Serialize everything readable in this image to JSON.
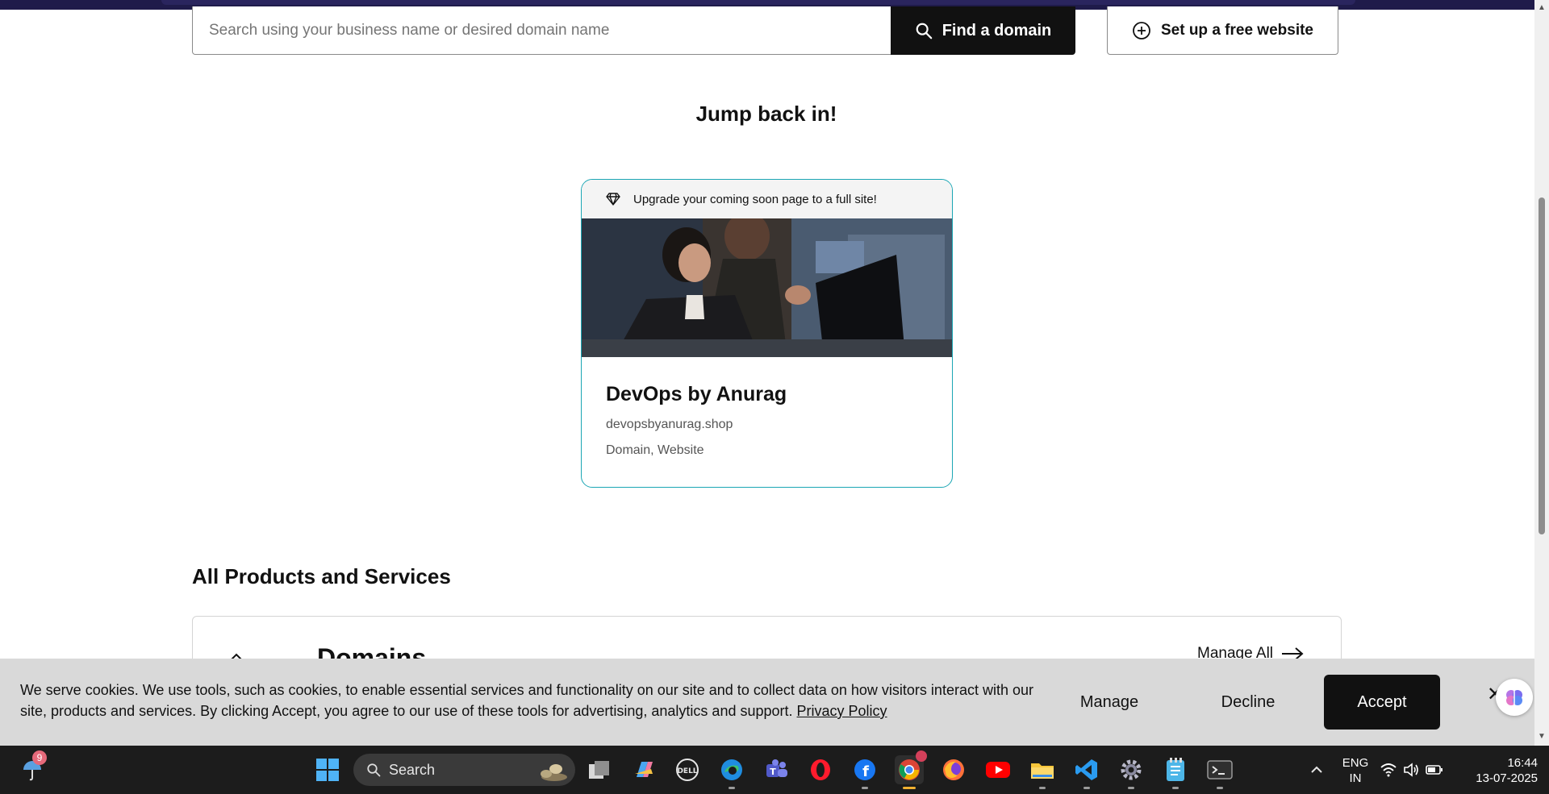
{
  "search": {
    "placeholder": "Search using your business name or desired domain name",
    "find_button": "Find a domain",
    "setup_button": "Set up a free website"
  },
  "jump_back": {
    "title": "Jump back in!",
    "card": {
      "banner": "Upgrade your coming soon page to a full site!",
      "name": "DevOps by Anurag",
      "domain": "devopsbyanurag.shop",
      "tags": "Domain, Website"
    }
  },
  "products": {
    "title": "All Products and Services",
    "section_heading": "Domains",
    "manage_all": "Manage All"
  },
  "cookie": {
    "text": "We serve cookies. We use tools, such as cookies, to enable essential services and functionality on our site and to collect data on how visitors interact with our site, products and services. By clicking Accept, you agree to our use of these tools for advertising, analytics and support.",
    "link": "Privacy Policy",
    "manage": "Manage",
    "decline": "Decline",
    "accept": "Accept"
  },
  "taskbar": {
    "weather_badge": "9",
    "search_label": "Search",
    "language_top": "ENG",
    "language_bottom": "IN",
    "time": "16:44",
    "date": "13-07-2025",
    "icons": [
      "windows-start-icon",
      "task-view-icon",
      "copilot-icon",
      "dell-icon",
      "edge-icon",
      "teams-icon",
      "opera-icon",
      "facebook-icon",
      "chrome-icon",
      "firefox-icon",
      "youtube-icon",
      "file-explorer-icon",
      "vscode-icon",
      "settings-icon",
      "notepad-icon",
      "terminal-icon"
    ]
  },
  "colors": {
    "accent_teal": "#1ba6b4",
    "dark": "#111111",
    "cookie_bg": "#d9d9d9",
    "taskbar_bg": "#1c1c1c"
  }
}
